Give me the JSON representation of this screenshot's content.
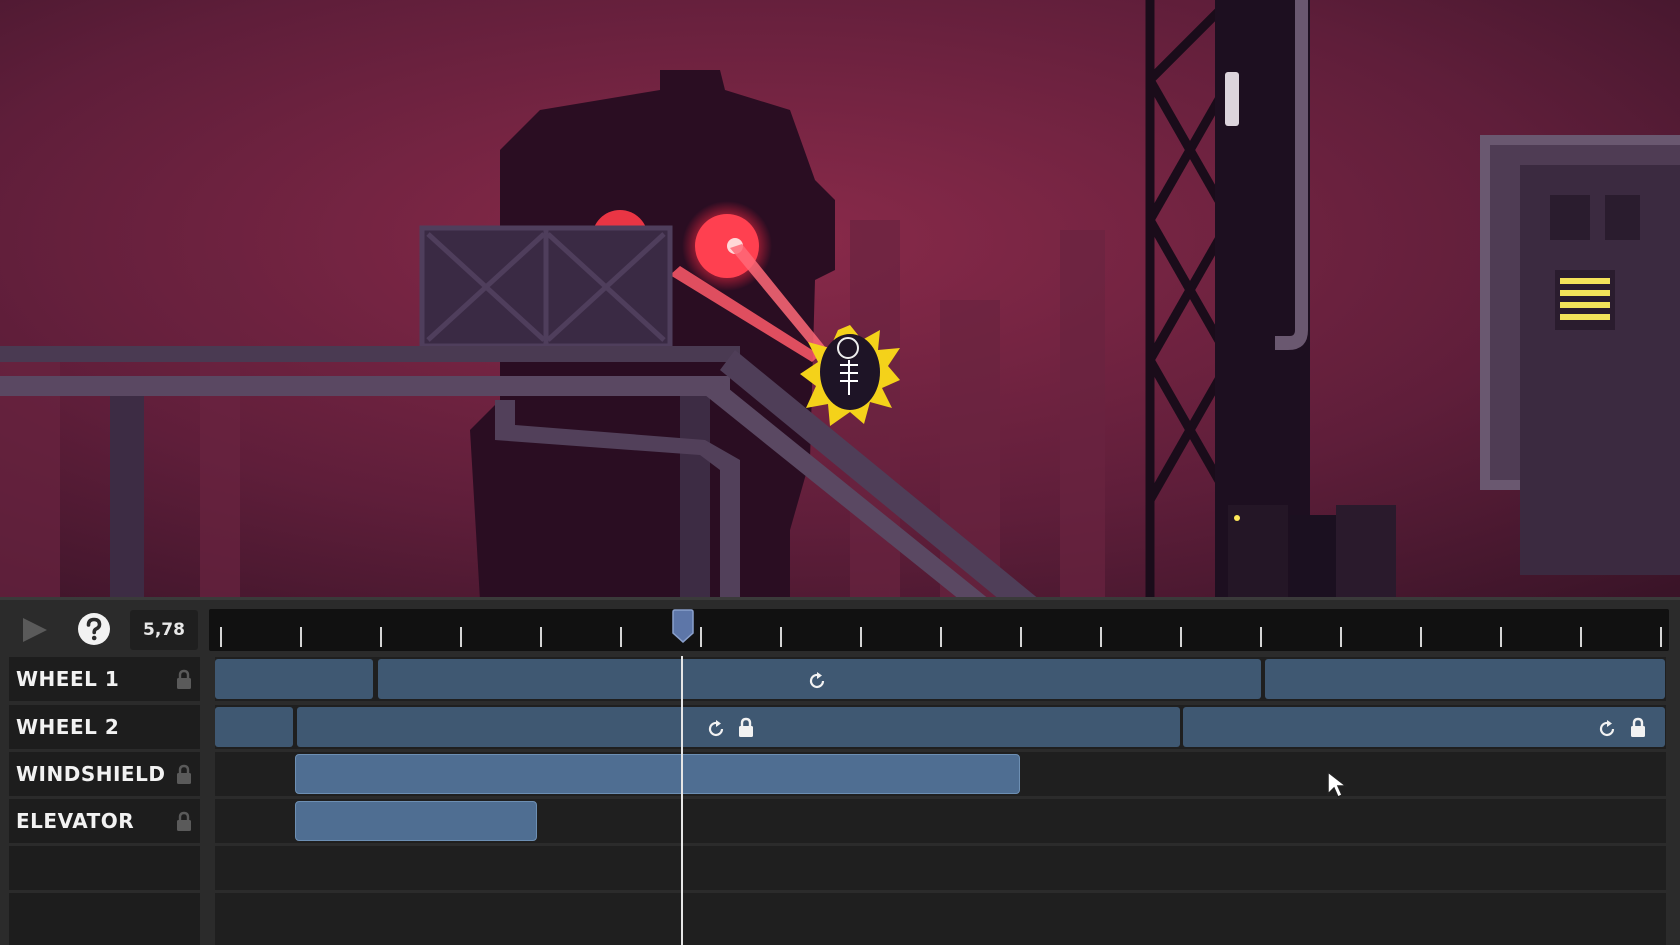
{
  "editor": {
    "time_display": "5,78",
    "icons": {
      "play": "play-icon",
      "help": "help-icon",
      "lock": "lock-icon",
      "loop": "loop-icon"
    },
    "tracks": [
      {
        "name": "WHEEL 1"
      },
      {
        "name": "WHEEL 2"
      },
      {
        "name": "WINDSHIELD"
      },
      {
        "name": "ELEVATOR"
      },
      {
        "name": ""
      },
      {
        "name": ""
      }
    ]
  },
  "colors": {
    "clip_dark": "#3f5872",
    "clip_light": "#4f6e92",
    "scene_bg": "#6b1f3a"
  }
}
